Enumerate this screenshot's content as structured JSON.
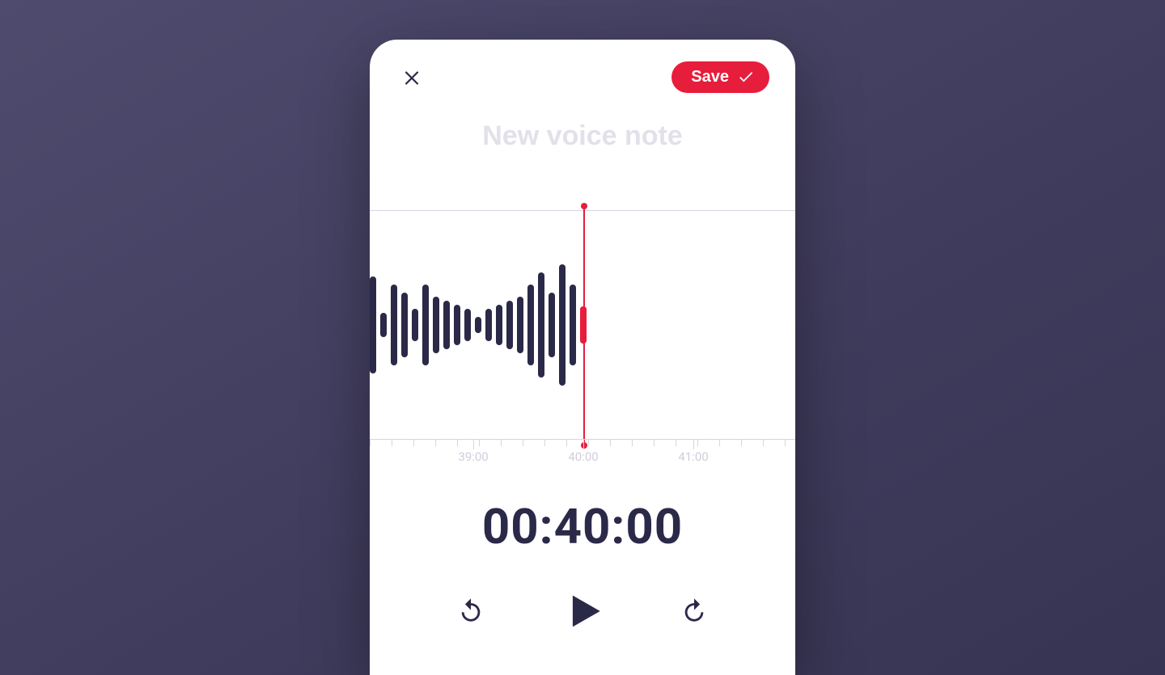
{
  "colors": {
    "accent": "#e71d3c",
    "ink": "#2b2948",
    "placeholder": "#e2e0ea"
  },
  "header": {
    "save_label": "Save",
    "title_value": "",
    "title_placeholder": "New voice note"
  },
  "timeline": {
    "playhead_time": "40:00",
    "tick_labels": [
      "39:00",
      "40:00",
      "41:00"
    ]
  },
  "time_display": "00:40:00",
  "waveform_bar_heights": [
    120,
    30,
    100,
    80,
    40,
    100,
    70,
    60,
    50,
    40,
    20,
    40,
    50,
    60,
    70,
    100,
    130,
    80,
    150,
    100,
    46
  ]
}
